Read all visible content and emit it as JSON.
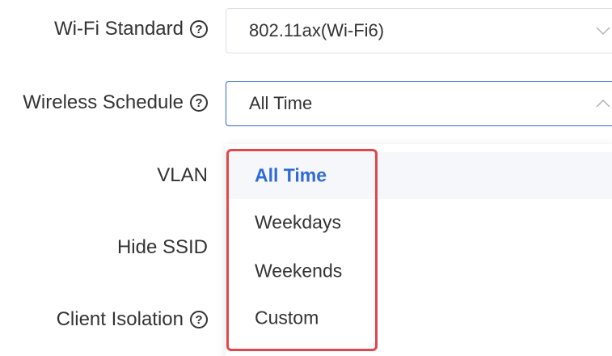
{
  "fields": {
    "wifi_standard": {
      "label": "Wi-Fi Standard",
      "value": "802.11ax(Wi-Fi6)"
    },
    "wireless_schedule": {
      "label": "Wireless Schedule",
      "value": "All Time"
    },
    "vlan": {
      "label": "VLAN"
    },
    "hide_ssid": {
      "label": "Hide SSID"
    },
    "client_isolation": {
      "label": "Client Isolation"
    }
  },
  "help_glyph": "?",
  "dropdown": {
    "options": [
      "All Time",
      "Weekdays",
      "Weekends",
      "Custom"
    ],
    "selected": "All Time"
  },
  "colors": {
    "accent": "#2f6ad6",
    "highlight": "#e0474c",
    "border": "#dcdfe6",
    "selected_bg": "#f5f7fa"
  },
  "icons": {
    "help": "help-circle-icon",
    "collapsed": "chevron-down-icon",
    "expanded": "chevron-up-icon"
  }
}
